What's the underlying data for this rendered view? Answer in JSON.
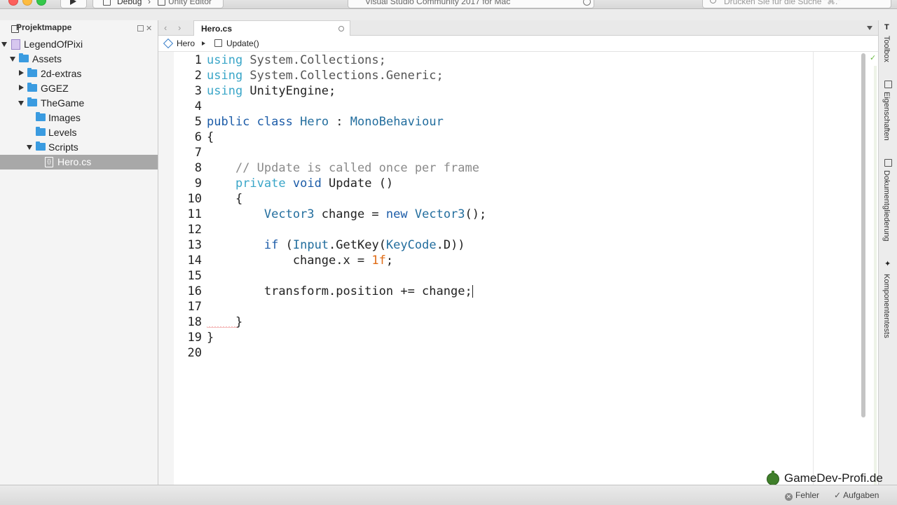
{
  "window": {
    "config_label": "Debug",
    "target_label": "Unity Editor",
    "status_text": "Visual Studio Community 2017 for Mac",
    "search_placeholder": "Drücken Sie für die Suche \"⌘.\""
  },
  "solution_pad": {
    "title": "Projektmappe",
    "items": [
      {
        "label": "LegendOfPixi",
        "type": "solution",
        "expanded": true
      },
      {
        "label": "Assets",
        "type": "folder",
        "expanded": true
      },
      {
        "label": "2d-extras",
        "type": "folder",
        "expanded": false
      },
      {
        "label": "GGEZ",
        "type": "folder",
        "expanded": false
      },
      {
        "label": "TheGame",
        "type": "folder",
        "expanded": true
      },
      {
        "label": "Images",
        "type": "folder"
      },
      {
        "label": "Levels",
        "type": "folder"
      },
      {
        "label": "Scripts",
        "type": "folder",
        "expanded": true
      },
      {
        "label": "Hero.cs",
        "type": "file",
        "selected": true,
        "icon_glyph": "{}"
      }
    ]
  },
  "editor": {
    "tab_label": "Hero.cs",
    "breadcrumb": {
      "class_name": "Hero",
      "member": "Update()"
    },
    "current_line": 16,
    "error_line": 18,
    "lines": [
      {
        "n": "1",
        "tokens": [
          [
            "kw2",
            "using"
          ],
          [
            "ns",
            " System.Collections;"
          ]
        ]
      },
      {
        "n": "2",
        "tokens": [
          [
            "kw2",
            "using"
          ],
          [
            "ns",
            " System.Collections.Generic;"
          ]
        ]
      },
      {
        "n": "3",
        "tokens": [
          [
            "kw2",
            "using"
          ],
          [
            "pl",
            " UnityEngine;"
          ]
        ]
      },
      {
        "n": "4",
        "tokens": []
      },
      {
        "n": "5",
        "tokens": [
          [
            "kw1",
            "public"
          ],
          [
            "pl",
            " "
          ],
          [
            "kw1",
            "class"
          ],
          [
            "pl",
            " "
          ],
          [
            "ty",
            "Hero"
          ],
          [
            "pl",
            " : "
          ],
          [
            "ty",
            "MonoBehaviour"
          ]
        ]
      },
      {
        "n": "6",
        "tokens": [
          [
            "pl",
            "{"
          ]
        ]
      },
      {
        "n": "7",
        "tokens": []
      },
      {
        "n": "8",
        "tokens": [
          [
            "pl",
            "    "
          ],
          [
            "cm",
            "// Update is called once per frame"
          ]
        ]
      },
      {
        "n": "9",
        "tokens": [
          [
            "pl",
            "    "
          ],
          [
            "kw3",
            "private"
          ],
          [
            "pl",
            " "
          ],
          [
            "kw1",
            "void"
          ],
          [
            "pl",
            " Update ()"
          ]
        ]
      },
      {
        "n": "10",
        "tokens": [
          [
            "pl",
            "    {"
          ]
        ]
      },
      {
        "n": "11",
        "tokens": [
          [
            "pl",
            "        "
          ],
          [
            "ty",
            "Vector3"
          ],
          [
            "pl",
            " change = "
          ],
          [
            "kw1",
            "new"
          ],
          [
            "pl",
            " "
          ],
          [
            "ty",
            "Vector3"
          ],
          [
            "pl",
            "();"
          ]
        ]
      },
      {
        "n": "12",
        "tokens": []
      },
      {
        "n": "13",
        "tokens": [
          [
            "pl",
            "        "
          ],
          [
            "kw1",
            "if"
          ],
          [
            "pl",
            " ("
          ],
          [
            "ty",
            "Input"
          ],
          [
            "pl",
            ".GetKey("
          ],
          [
            "ty",
            "KeyCode"
          ],
          [
            "pl",
            ".D))"
          ]
        ]
      },
      {
        "n": "14",
        "tokens": [
          [
            "pl",
            "            change.x = "
          ],
          [
            "num",
            "1f"
          ],
          [
            "pl",
            ";"
          ]
        ]
      },
      {
        "n": "15",
        "tokens": []
      },
      {
        "n": "16",
        "tokens": [
          [
            "pl",
            "        transform.position += change;"
          ]
        ]
      },
      {
        "n": "17",
        "tokens": []
      },
      {
        "n": "18",
        "tokens": [
          [
            "pl",
            "    }"
          ]
        ]
      },
      {
        "n": "19",
        "tokens": [
          [
            "pl",
            "}"
          ]
        ]
      },
      {
        "n": "20",
        "tokens": []
      }
    ]
  },
  "right_tools": [
    {
      "label": "Toolbox",
      "icon": "toolbox-icon"
    },
    {
      "label": "Eigenschaften",
      "icon": "properties-icon"
    },
    {
      "label": "Dokumentgliederung",
      "icon": "outline-icon"
    },
    {
      "label": "Komponententests",
      "icon": "unit-tests-icon"
    }
  ],
  "statusbar": {
    "errors_label": "Fehler",
    "tasks_label": "Aufgaben"
  },
  "watermark": "GameDev-Profi.de",
  "colors": {
    "kw1": "#1c5ca8",
    "kw2": "#3aa6c8",
    "kw3": "#3aa6c8",
    "ty": "#236e9e",
    "ns": "#555555",
    "pl": "#222222",
    "cm": "#8a8a8a",
    "num": "#e06b15",
    "selection": "#a8a8a8",
    "folder": "#3a9be0"
  }
}
